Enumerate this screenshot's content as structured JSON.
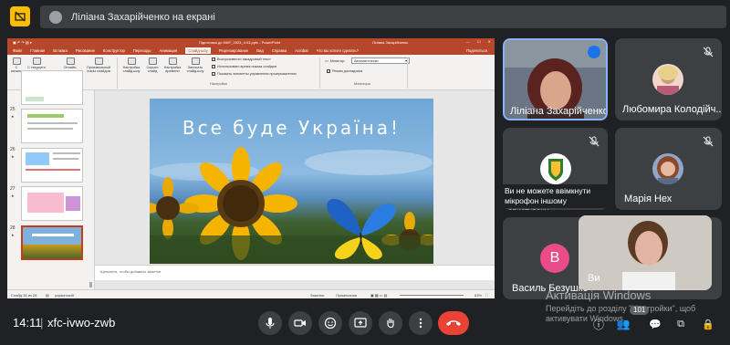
{
  "top": {
    "presenting_text": "Ліліана Захарійченко на екрані"
  },
  "ppt": {
    "window_title": "Підготовка до НМТ_2023_4.03.pptx - PowerPoint",
    "user": "Ліліана Захарійченко",
    "tabs": [
      "Файл",
      "Главная",
      "Вставка",
      "Рисование",
      "Конструктор",
      "Переходы",
      "Анимация",
      "Слайд-шоу",
      "Рецензирование",
      "Вид",
      "Справка",
      "Acrobat",
      "Что вы хотите сделать?"
    ],
    "active_tab": "Слайд-шоу",
    "share": "Поделиться",
    "ribbon": {
      "btn_start": "С начала",
      "btn_current": "С текущего слайда",
      "btn_online": "Онлайн-презентация",
      "btn_custom": "Произвольный показ слайдов",
      "group_start": "Начать слайд-шоу",
      "btn_setup": "Настройка слайд-шоу",
      "btn_hide": "Скрыть слайд",
      "btn_timing": "Настройка времени",
      "btn_record": "Записать слайд-шоу",
      "check1": "Воспроизвести закадровый текст",
      "check2": "Использовать время показа слайдов",
      "check3": "Показать элементы управления проигрывателем",
      "group_setup": "Настройка",
      "monitor_label": "Монитор:",
      "monitor_value": "Автоматически",
      "presenter_view": "Режим докладчика",
      "group_monitors": "Мониторы"
    },
    "slide_numbers": [
      "",
      "25",
      "26",
      "27",
      "28"
    ],
    "slide_title": "Все буде Україна!",
    "notes_placeholder": "Щелкните, чтобы добавить заметки",
    "status": {
      "slide": "Слайд 28 из 28",
      "lang": "украинский",
      "notes": "Заметки",
      "comments": "Примечания",
      "zoom": "63%"
    }
  },
  "participants": [
    {
      "name": "Ліліана Захарійченко"
    },
    {
      "name": "Любомира Колодійч..."
    },
    {
      "name": "Ви не можете ввімкнути мікрофон іншому користувачу"
    },
    {
      "name": "Марія Нех"
    },
    {
      "name": "Василь Безушко",
      "initial": "В"
    },
    {
      "name": "Ви"
    }
  ],
  "windows_watermark": {
    "title": "Активація Windows",
    "subtitle": "Перейдіть до розділу \"Настройки\", щоб активувати Windows."
  },
  "bottom": {
    "time": "14:11",
    "separator": "|",
    "meeting_code": "xfc-ivwo-zwb",
    "participants_count": "101"
  },
  "colors": {
    "meet_bg": "#202124",
    "tile_bg": "#3c4043",
    "ppt_accent": "#b7472a",
    "end_call": "#ea4335",
    "avatar_v": "#ea4c89",
    "speaking": "#8ab4f8"
  }
}
